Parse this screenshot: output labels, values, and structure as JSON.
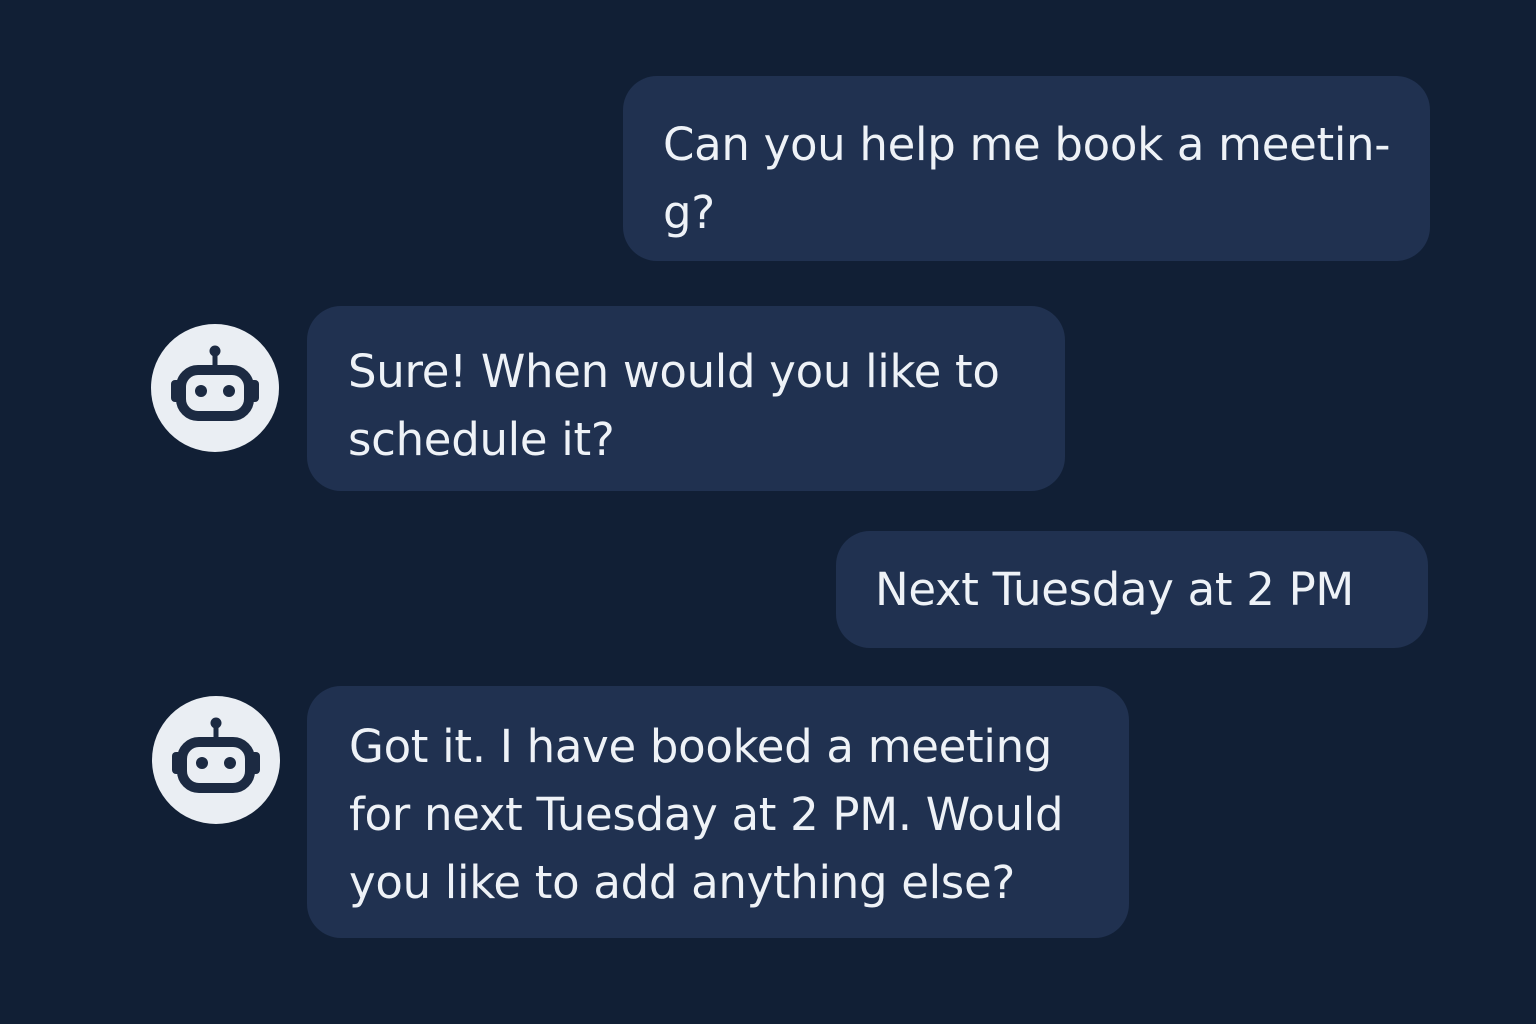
{
  "messages": [
    {
      "sender": "user",
      "lines": [
        "Can you help me book a meetin-",
        "g?"
      ]
    },
    {
      "sender": "bot",
      "avatar_icon": "robot-icon",
      "lines": [
        "Sure! When would you like to",
        "schedule it?"
      ]
    },
    {
      "sender": "user",
      "lines": [
        "Next Tuesday at 2 PM"
      ]
    },
    {
      "sender": "bot",
      "avatar_icon": "robot-icon",
      "lines": [
        "Got it. I have booked a meeting",
        "for next Tuesday at 2 PM. Would",
        "you like to add anything else?"
      ]
    }
  ],
  "colors": {
    "background": "#111f35",
    "bubble": "#203150",
    "text": "#eef2f7",
    "avatar_bg": "#eaeef3",
    "icon": "#1c2a42"
  }
}
